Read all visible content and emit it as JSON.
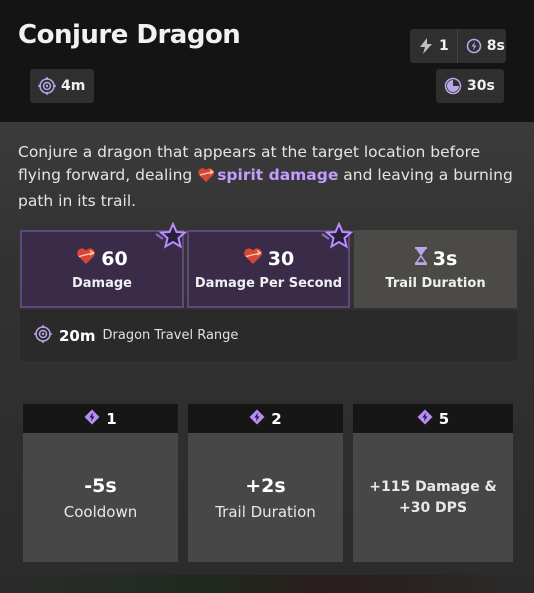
{
  "title": "Conjure Dragon",
  "charges": "1",
  "charge_cooldown": "8s",
  "range": "4m",
  "cooldown": "30s",
  "description": {
    "before": "Conjure a dragon that appears at the target location before flying forward, dealing ",
    "keyword": "spirit damage",
    "after": " and leaving a burning path in its trail."
  },
  "stats": [
    {
      "value": "60",
      "label": "Damage",
      "icon": "heart-icon",
      "boosted": true
    },
    {
      "value": "30",
      "label": "Damage Per Second",
      "icon": "heart-icon",
      "boosted": true
    },
    {
      "value": "3s",
      "label": "Trail Duration",
      "icon": "hourglass-icon",
      "boosted": false
    }
  ],
  "travel_range": {
    "value": "20m",
    "label": "Dragon Travel Range"
  },
  "upgrades": [
    {
      "cost": "1",
      "line1": "-5s",
      "line2": "Cooldown"
    },
    {
      "cost": "2",
      "line1": "+2s",
      "line2": "Trail Duration"
    },
    {
      "cost": "5",
      "line1": "+115 Damage &",
      "line2": "+30 DPS"
    }
  ],
  "colors": {
    "accent_purple": "#c49cff",
    "boosted_bg": "#3a2c48",
    "heart_red": "#d8453a"
  }
}
